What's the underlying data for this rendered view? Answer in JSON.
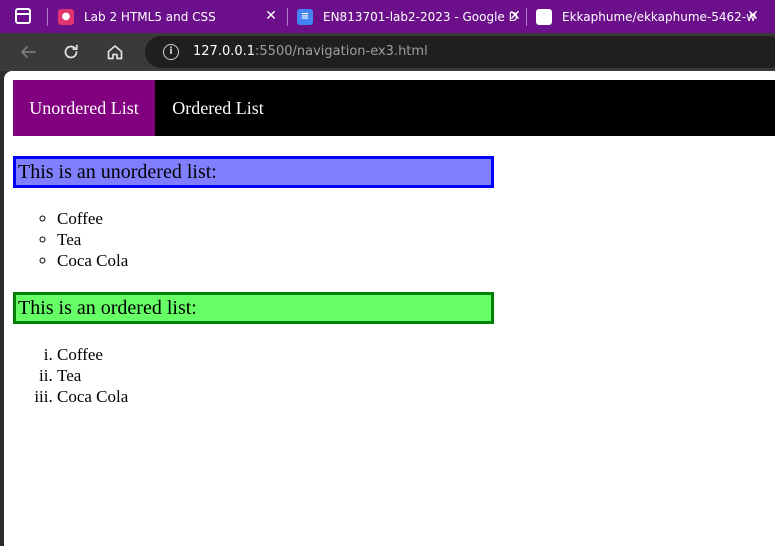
{
  "browser": {
    "tabs": [
      {
        "title": "Lab 2 HTML5 and CSS",
        "icon": "classroom-icon"
      },
      {
        "title": "EN813701-lab2-2023 - Google D",
        "icon": "google-docs-icon"
      },
      {
        "title": "Ekkaphume/ekkaphume-5462-w",
        "icon": "github-icon"
      }
    ],
    "close_glyph": "✕",
    "address": {
      "host": "127.0.0.1",
      "rest": ":5500/navigation-ex3.html"
    }
  },
  "page": {
    "nav": {
      "unordered": "Unordered List",
      "ordered": "Ordered List"
    },
    "unordered_heading": "This is an unordered list:",
    "unordered_items": [
      "Coffee",
      "Tea",
      "Coca Cola"
    ],
    "ordered_heading": "This is an ordered list:",
    "ordered_items": [
      "Coffee",
      "Tea",
      "Coca Cola"
    ]
  },
  "colors": {
    "tab_strip": "#6b0f8a",
    "nav_active": "#800080",
    "nav_bg": "#000000",
    "ul_box_bg": "#8080ff",
    "ul_box_border": "#0000ff",
    "ol_box_bg": "#66ff66",
    "ol_box_border": "#008000"
  }
}
